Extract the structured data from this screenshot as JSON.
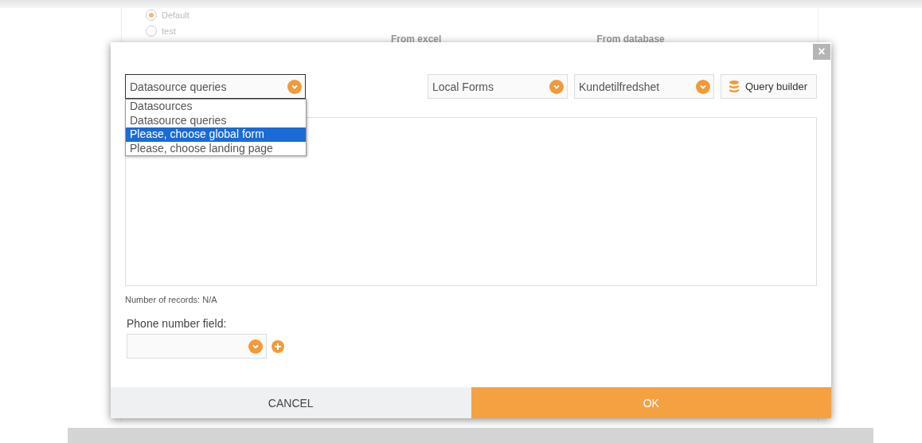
{
  "background": {
    "radios": [
      {
        "label": "Default",
        "selected": true
      },
      {
        "label": "test",
        "selected": false
      }
    ],
    "columns": [
      "From excel",
      "From database"
    ]
  },
  "dialog": {
    "close": "×",
    "source_select": {
      "value": "Datasource queries",
      "expanded": true,
      "options": [
        {
          "label": "Datasources",
          "highlighted": false
        },
        {
          "label": "Datasource queries",
          "highlighted": false
        },
        {
          "label": "Please, choose global form",
          "highlighted": true
        },
        {
          "label": "Please, choose landing page",
          "highlighted": false
        }
      ]
    },
    "form_select": {
      "value": "Local Forms"
    },
    "item_select": {
      "value": "Kundetilfredshet"
    },
    "query_builder": "Query builder",
    "records": "Number of records: N/A",
    "phone_label": "Phone number field:",
    "buttons": [
      {
        "label": "CANCEL",
        "kind": "secondary"
      },
      {
        "label": "OK",
        "kind": "primary"
      }
    ]
  }
}
